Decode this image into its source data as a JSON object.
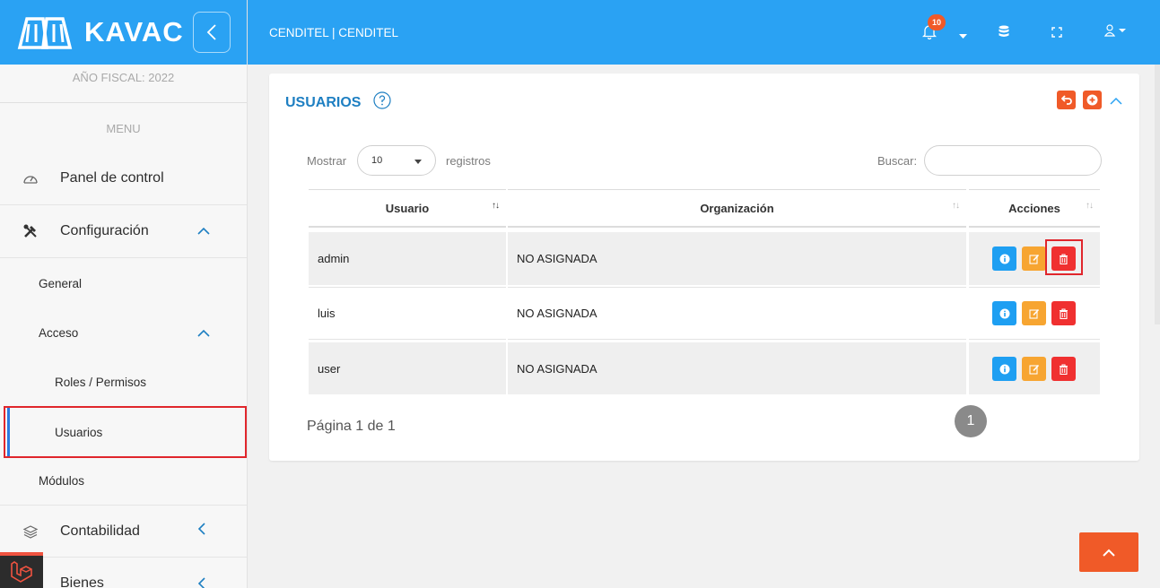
{
  "brand": {
    "name": "KAVAC"
  },
  "sidebar": {
    "fiscal_year": "AÑO FISCAL: 2022",
    "menu_title": "MENU",
    "items": {
      "panel": "Panel de control",
      "configuracion": "Configuración",
      "general": "General",
      "acceso": "Acceso",
      "roles": "Roles / Permisos",
      "usuarios": "Usuarios",
      "modulos": "Módulos",
      "contabilidad": "Contabilidad",
      "bienes": "Bienes"
    }
  },
  "topbar": {
    "organization": "CENDITEL | CENDITEL",
    "notification_count": "10",
    "icons": [
      "bell-icon",
      "dropdown-caret-icon",
      "database-icon",
      "fullscreen-icon",
      "user-icon"
    ]
  },
  "card": {
    "title": "USUARIOS",
    "show_label": "Mostrar",
    "page_size": "10",
    "records_label": "registros",
    "search_label": "Buscar:",
    "search_value": "",
    "columns": [
      "Usuario",
      "Organización",
      "Acciones"
    ],
    "rows": [
      {
        "user": "admin",
        "org": "NO ASIGNADA"
      },
      {
        "user": "luis",
        "org": "NO ASIGNADA"
      },
      {
        "user": "user",
        "org": "NO ASIGNADA"
      }
    ],
    "pagination_info": "Página 1 de 1",
    "current_page": "1"
  },
  "colors": {
    "primary_blue": "#2aa2f3",
    "accent_orange": "#f05a28",
    "info_blue": "#1e9ff2",
    "edit_orange": "#f7a531",
    "delete_red": "#f03030",
    "highlight_red": "#e0262c"
  }
}
